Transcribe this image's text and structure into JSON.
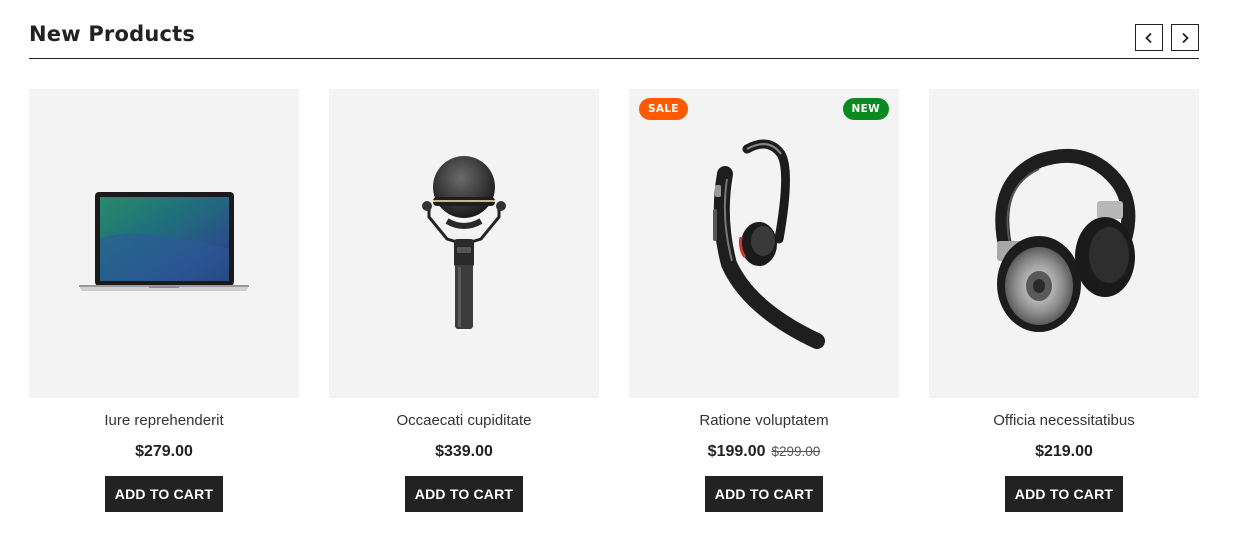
{
  "section": {
    "title": "New Products",
    "prev_icon": "chevron-left-icon",
    "next_icon": "chevron-right-icon"
  },
  "products": [
    {
      "name": "Iure reprehenderit",
      "price": "$279.00",
      "old_price": "",
      "image": "laptop",
      "cart_label": "ADD TO CART"
    },
    {
      "name": "Occaecati cupiditate",
      "price": "$339.00",
      "old_price": "",
      "image": "microphone",
      "cart_label": "ADD TO CART"
    },
    {
      "name": "Ratione voluptatem",
      "price": "$199.00",
      "old_price": "$299.00",
      "image": "bluetooth-headset",
      "badges": {
        "sale": "SALE",
        "new": "NEW"
      },
      "cart_label": "ADD TO CART"
    },
    {
      "name": "Officia necessitatibus",
      "price": "$219.00",
      "old_price": "",
      "image": "headphones",
      "cart_label": "ADD TO CART"
    }
  ],
  "colors": {
    "sale_badge": "#ff5a00",
    "new_badge": "#0a8a1f",
    "button_bg": "#222222",
    "thumb_bg": "#f3f3f3"
  }
}
